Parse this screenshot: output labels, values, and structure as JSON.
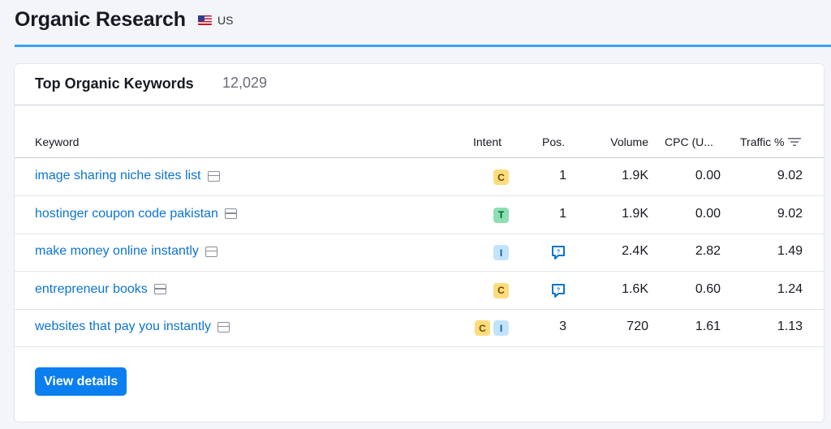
{
  "header": {
    "title": "Organic Research",
    "country": "US",
    "flag_icon": "us-flag-icon",
    "accent_color": "#3aa2f6"
  },
  "card": {
    "title": "Top Organic Keywords",
    "count": "12,029"
  },
  "table": {
    "columns": {
      "keyword": "Keyword",
      "intent": "Intent",
      "pos": "Pos.",
      "volume": "Volume",
      "cpc": "CPC (U...",
      "traffic": "Traffic %"
    },
    "rows": [
      {
        "keyword": "image sharing niche sites list",
        "intents": [
          "C"
        ],
        "pos": "1",
        "pos_icon": null,
        "volume": "1.9K",
        "cpc": "0.00",
        "traffic": "9.02"
      },
      {
        "keyword": "hostinger coupon code pakistan",
        "intents": [
          "T"
        ],
        "pos": "1",
        "pos_icon": null,
        "volume": "1.9K",
        "cpc": "0.00",
        "traffic": "9.02"
      },
      {
        "keyword": "make money online instantly",
        "intents": [
          "I"
        ],
        "pos": "",
        "pos_icon": "serp-feature-icon",
        "volume": "2.4K",
        "cpc": "2.82",
        "traffic": "1.49"
      },
      {
        "keyword": "entrepreneur books",
        "intents": [
          "C"
        ],
        "pos": "",
        "pos_icon": "serp-feature-icon",
        "volume": "1.6K",
        "cpc": "0.60",
        "traffic": "1.24"
      },
      {
        "keyword": "websites that pay you instantly",
        "intents": [
          "C",
          "I"
        ],
        "pos": "3",
        "pos_icon": null,
        "volume": "720",
        "cpc": "1.61",
        "traffic": "1.13"
      }
    ]
  },
  "actions": {
    "view_details": "View details"
  },
  "colors": {
    "link": "#0b74d2",
    "button": "#0b7ef0",
    "intent_commercial": "#fcdc7d",
    "intent_transactional": "#8be0b2",
    "intent_informational": "#c2e3fb"
  }
}
